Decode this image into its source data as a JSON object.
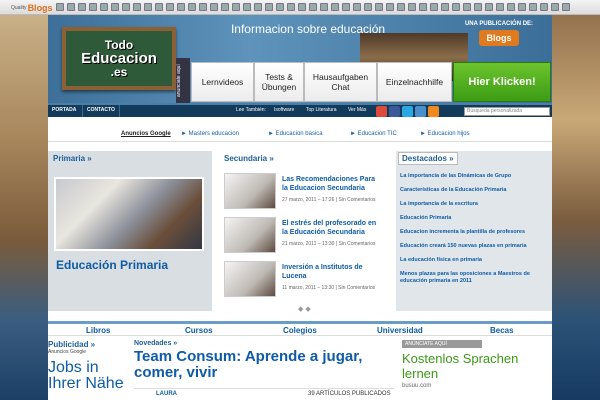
{
  "topbar": {
    "logo_quality": "Quality",
    "logo_blogs": "Blogs"
  },
  "header": {
    "logo_line1": "Todo",
    "logo_line2": "Educacion",
    "logo_line3": ".es",
    "info_text": "Informacion sobre educación",
    "pub_text": "UNA PUBLICACIÓN DE:",
    "pub_logo": "Blogs",
    "ad_label": "anunciate aquí",
    "ad_buttons": [
      "Lernvideos",
      "Tests & Übungen",
      "Hausaufgaben Chat",
      "Einzelnachhilfe",
      "Hier Klicken!"
    ]
  },
  "nav": {
    "portada": "PORTADA",
    "contacto": "CONTACTO",
    "lee_tambien": "Lee También:",
    "links": [
      "Isoftware",
      "Top Literatura",
      "Ver Más"
    ],
    "search_placeholder": "Búsqueda personalizada"
  },
  "ads_bar": {
    "label": "Anuncios Google",
    "links": [
      "► Masters educacion",
      "► Educacion basica",
      "► Educacion TIC",
      "► Educacion hijos"
    ]
  },
  "primaria": {
    "heading": "Primaria »",
    "caption": "Educación Primaria"
  },
  "secundaria": {
    "heading": "Secundaria »",
    "items": [
      {
        "title": "Las Recomendaciones Para la Educacion Secundaria",
        "date": "27 marzo, 2011 – 17:26 | Sin Comentarios"
      },
      {
        "title": "El estrés del profesorado en la Educación Secundaria",
        "date": "21 marzo, 2011 – 13:30 | Sin Comentarios"
      },
      {
        "title": "Inversión a Institutos de Lucena",
        "date": "11 marzo, 2011 – 13:30 | Sin Comentarios"
      }
    ],
    "arrows": "◆ ◆"
  },
  "destacados": {
    "heading": "Destacados »",
    "items": [
      "La importancia de las Dinámicas de Grupo",
      "Características de la Educación Primaria",
      "La importancia de la escritura",
      "Educación Primaria",
      "Educacion incrementa la plantilla de profesores",
      "Educación creará 150 nuevas plazas en primaria",
      "La educación física en primaria",
      "Menos plazas para las oposiciones a Maestros de educación primaria en 2011"
    ]
  },
  "categories": [
    "Libros",
    "Cursos",
    "Colegios",
    "Universidad",
    "Becas"
  ],
  "publicidad": {
    "heading": "Publicidad »",
    "google": "Anuncios Google",
    "jobs": "Jobs in Ihrer Nähe"
  },
  "novedades": {
    "heading": "Novedades »",
    "title": "Team Consum: Aprende a jugar, comer, vivir",
    "author": "LAURA",
    "count": "39 ARTÍCULOS PUBLICADOS"
  },
  "ad_block": {
    "label": "ANÚNCIATE AQUÍ",
    "text": "Kostenlos Sprachen lernen",
    "url": "busuu.com"
  }
}
